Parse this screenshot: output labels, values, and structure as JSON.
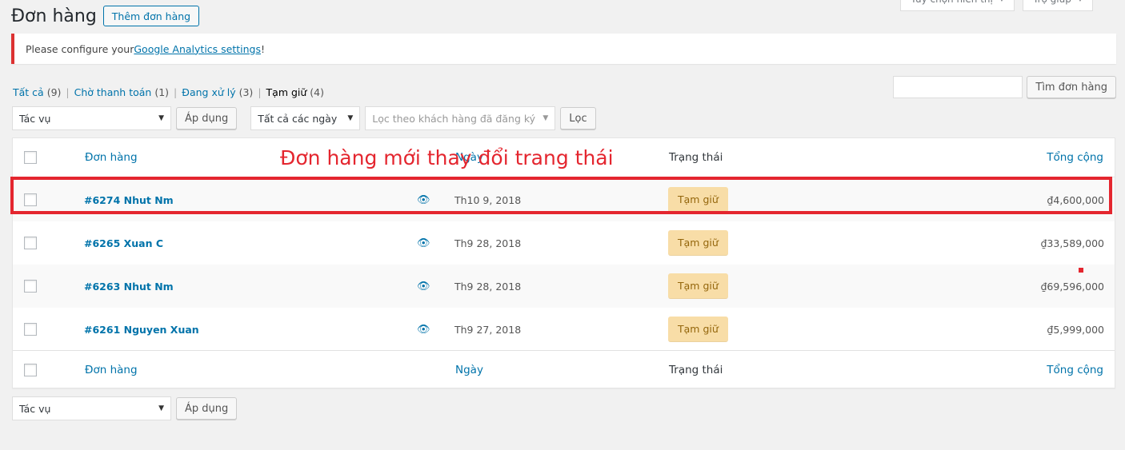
{
  "screen_meta": {
    "options_label": "Tùy chọn hiển thị",
    "help_label": "Trợ giúp"
  },
  "header": {
    "title": "Đơn hàng",
    "add_button": "Thêm đơn hàng"
  },
  "notice": {
    "text_before": "Please configure your ",
    "link": "Google Analytics settings",
    "text_after": "!"
  },
  "filters": [
    {
      "label": "Tất cả",
      "count": "(9)"
    },
    {
      "label": "Chờ thanh toán",
      "count": "(1)"
    },
    {
      "label": "Đang xử lý",
      "count": "(3)"
    },
    {
      "label": "Tạm giữ",
      "count": "(4)"
    }
  ],
  "search": {
    "value": "",
    "button": "Tìm đơn hàng"
  },
  "tablenav_top": {
    "bulk_action": "Tác vụ",
    "apply": "Áp dụng",
    "date_filter": "Tất cả các ngày",
    "customer_filter_placeholder": "Lọc theo khách hàng đã đăng ký",
    "filter_button": "Lọc"
  },
  "columns": {
    "order": "Đơn hàng",
    "date": "Ngày",
    "status": "Trạng thái",
    "total": "Tổng cộng"
  },
  "orders": [
    {
      "id": "#6274 Nhut Nm",
      "date": "Th10 9, 2018",
      "status": "Tạm giữ",
      "total": "₫4,600,000"
    },
    {
      "id": "#6265 Xuan C",
      "date": "Th9 28, 2018",
      "status": "Tạm giữ",
      "total": "₫33,589,000"
    },
    {
      "id": "#6263 Nhut Nm",
      "date": "Th9 28, 2018",
      "status": "Tạm giữ",
      "total": "₫69,596,000"
    },
    {
      "id": "#6261 Nguyen Xuan",
      "date": "Th9 27, 2018",
      "status": "Tạm giữ",
      "total": "₫5,999,000"
    }
  ],
  "tablenav_bottom": {
    "bulk_action": "Tác vụ",
    "apply": "Áp dụng"
  },
  "annotation": {
    "text": "Đơn hàng mới thay đổi trang thái",
    "color": "#e4262f"
  },
  "colors": {
    "link": "#0073aa",
    "status_bg": "#f8dda7",
    "status_text": "#94660c",
    "notice_border": "#dc3232"
  }
}
